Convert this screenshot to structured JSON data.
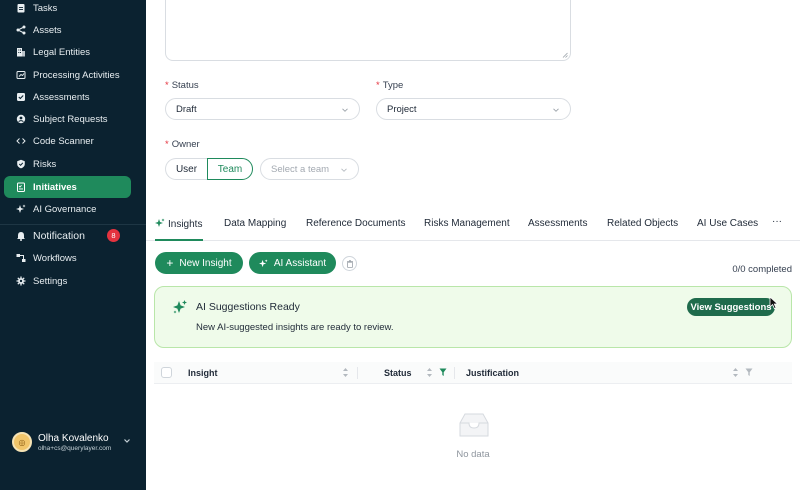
{
  "sidebar": {
    "items": [
      {
        "label": "Tasks",
        "icon": "clipboard-icon"
      },
      {
        "label": "Assets",
        "icon": "share-icon"
      },
      {
        "label": "Legal Entities",
        "icon": "building-icon"
      },
      {
        "label": "Processing Activities",
        "icon": "process-icon"
      },
      {
        "label": "Assessments",
        "icon": "checklist-icon"
      },
      {
        "label": "Subject Requests",
        "icon": "user-circle-icon"
      },
      {
        "label": "Code Scanner",
        "icon": "code-icon"
      },
      {
        "label": "Risks",
        "icon": "shield-icon"
      },
      {
        "label": "Initiatives",
        "icon": "initiative-icon",
        "active": true
      },
      {
        "label": "AI Governance",
        "icon": "sparkle-icon"
      }
    ],
    "notification": {
      "label": "Notification",
      "count": "8"
    },
    "bottom_items": [
      {
        "label": "Workflows",
        "icon": "workflow-icon"
      },
      {
        "label": "Settings",
        "icon": "gear-icon"
      }
    ],
    "user": {
      "name": "Olha Kovalenko",
      "email": "olha+cs@querylayer.com"
    }
  },
  "form": {
    "status": {
      "label": "Status",
      "value": "Draft"
    },
    "type": {
      "label": "Type",
      "value": "Project"
    },
    "owner": {
      "label": "Owner",
      "user_option": "User",
      "team_option": "Team",
      "team_placeholder": "Select a team"
    }
  },
  "tabs": [
    "Insights",
    "Data Mapping",
    "Reference Documents",
    "Risks Management",
    "Assessments",
    "Related Objects",
    "AI Use Cases",
    "···"
  ],
  "toolbar": {
    "new_insight": "New Insight",
    "ai_assistant": "AI Assistant",
    "completed": "0/0 completed"
  },
  "banner": {
    "title": "AI Suggestions Ready",
    "text": "New AI-suggested insights are ready to review.",
    "button": "View Suggestions"
  },
  "table": {
    "columns": [
      "Insight",
      "Status",
      "Justification"
    ],
    "empty": "No data"
  },
  "colors": {
    "accent": "#1f8a5c",
    "sidebar_bg": "#0b2230",
    "banner_bg": "#effbea",
    "badge": "#e4333f"
  }
}
